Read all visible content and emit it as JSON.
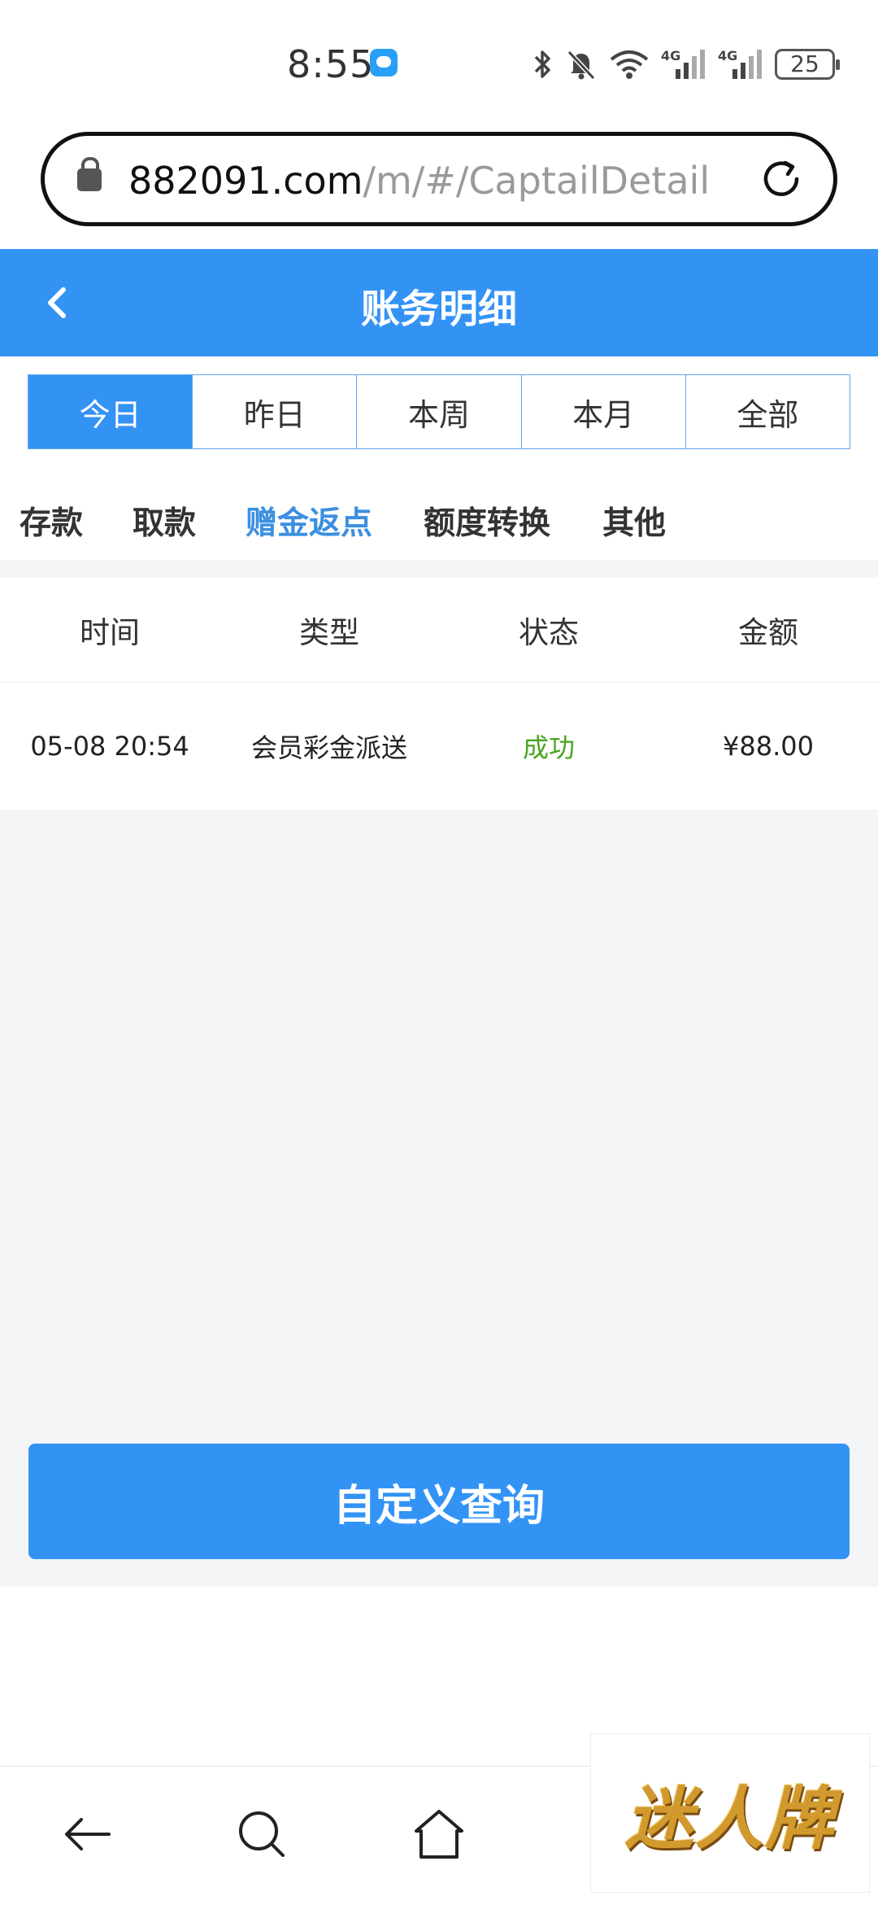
{
  "status_bar": {
    "time": "8:55",
    "battery": "25",
    "network_label_1": "4G",
    "network_label_2": "4G",
    "icons": [
      "message-icon",
      "bluetooth-icon",
      "mute-bell-icon",
      "wifi-icon",
      "signal-icon",
      "signal-icon",
      "battery-icon"
    ]
  },
  "browser": {
    "url_host": "882091.com",
    "url_path": "/m/#/CaptailDetail"
  },
  "header": {
    "title": "账务明细"
  },
  "period_tabs": [
    {
      "label": "今日",
      "active": true
    },
    {
      "label": "昨日",
      "active": false
    },
    {
      "label": "本周",
      "active": false
    },
    {
      "label": "本月",
      "active": false
    },
    {
      "label": "全部",
      "active": false
    }
  ],
  "category_tabs": [
    {
      "label": "存款",
      "active": false
    },
    {
      "label": "取款",
      "active": false
    },
    {
      "label": "赠金返点",
      "active": true
    },
    {
      "label": "额度转换",
      "active": false
    },
    {
      "label": "其他",
      "active": false
    }
  ],
  "table": {
    "headers": [
      "时间",
      "类型",
      "状态",
      "金额"
    ],
    "rows": [
      {
        "time": "05-08 20:54",
        "type": "会员彩金派送",
        "status": "成功",
        "amount": "¥88.00"
      }
    ]
  },
  "query_button": "自定义查询",
  "watermark": "迷人牌",
  "colors": {
    "primary": "#3393f5",
    "active_text": "#3b8fe0",
    "success": "#4aa520",
    "background": "#f4f5f7"
  }
}
